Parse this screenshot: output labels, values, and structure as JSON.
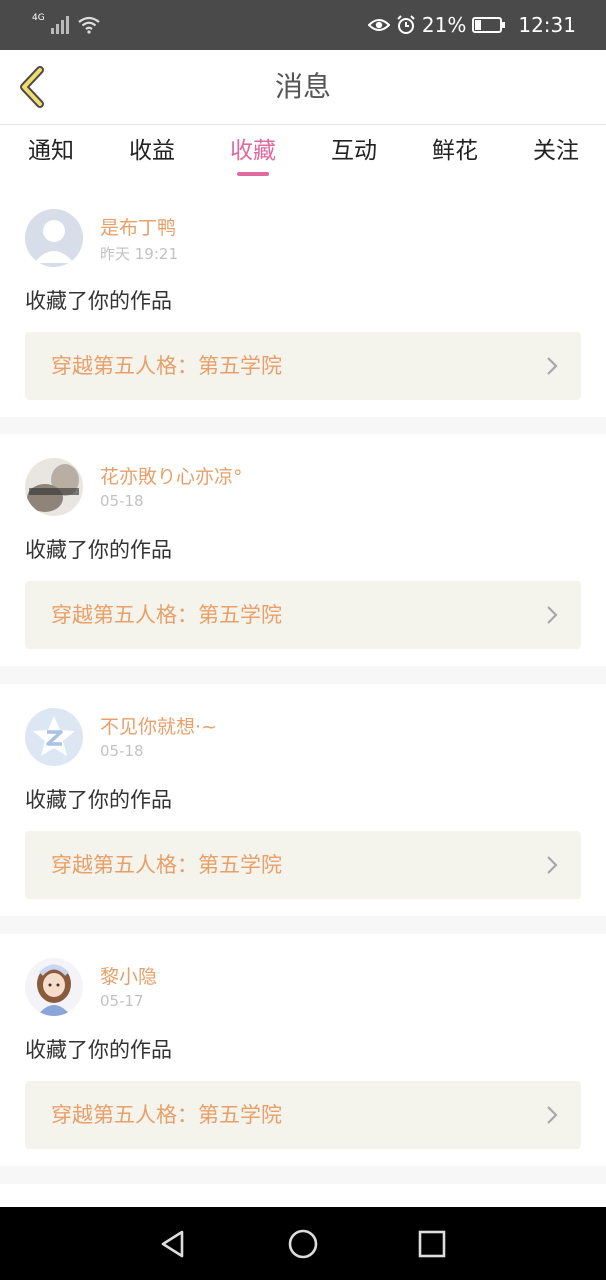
{
  "status_bar": {
    "network": "4G",
    "battery": "21%",
    "time": "12:31"
  },
  "header": {
    "title": "消息"
  },
  "tabs": [
    {
      "label": "通知",
      "active": false
    },
    {
      "label": "收益",
      "active": false
    },
    {
      "label": "收藏",
      "active": true
    },
    {
      "label": "互动",
      "active": false
    },
    {
      "label": "鲜花",
      "active": false
    },
    {
      "label": "关注",
      "active": false
    }
  ],
  "colors": {
    "accent_pink": "#e06aa0",
    "name_orange": "#e8a06a",
    "work_bg": "#f4f3ec"
  },
  "feed": [
    {
      "user": "是布丁鸭",
      "time": "昨天 19:21",
      "action": "收藏了你的作品",
      "work": "穿越第五人格：第五学院",
      "avatar": "default-avatar"
    },
    {
      "user": "花亦敗り心亦凉°",
      "time": "05-18",
      "action": "收藏了你的作品",
      "work": "穿越第五人格：第五学院",
      "avatar": "photo-avatar"
    },
    {
      "user": "不见你就想·~",
      "time": "05-18",
      "action": "收藏了你的作品",
      "work": "穿越第五人格：第五学院",
      "avatar": "z-logo-avatar"
    },
    {
      "user": "黎小隐",
      "time": "05-17",
      "action": "收藏了你的作品",
      "work": "穿越第五人格：第五学院",
      "avatar": "anime-girl-avatar"
    }
  ]
}
